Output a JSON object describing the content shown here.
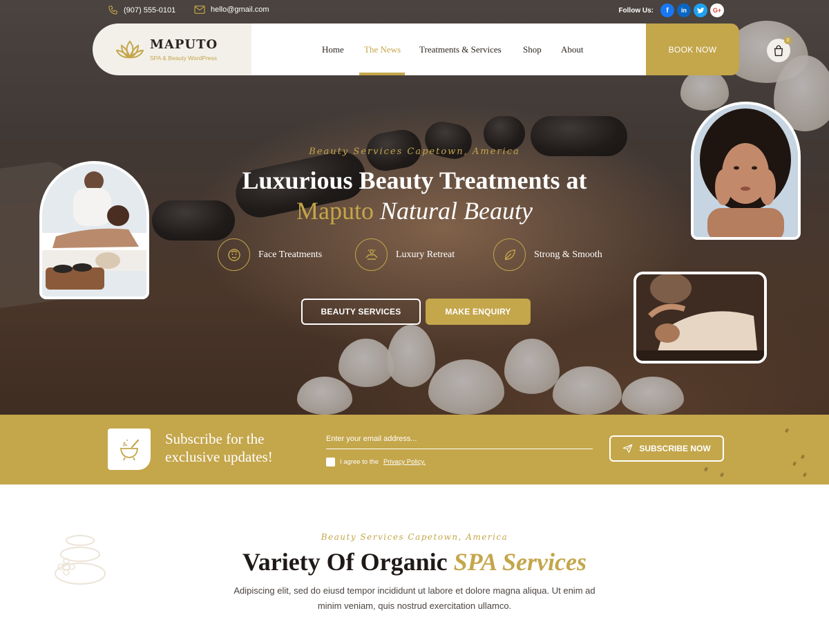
{
  "topbar": {
    "phone": "(907) 555-0101",
    "email": "hello@gmail.com",
    "follow_label": "Follow Us:",
    "social": [
      {
        "icon": "facebook-icon",
        "glyph": "f",
        "color": "#1877f2"
      },
      {
        "icon": "linkedin-icon",
        "glyph": "in",
        "color": "#0a66c2"
      },
      {
        "icon": "twitter-icon",
        "glyph": "t",
        "color": "#1da1f2"
      },
      {
        "icon": "google-plus-icon",
        "glyph": "G+",
        "color": "#ffffff"
      }
    ]
  },
  "nav": {
    "brand_name": "MAPUTO",
    "brand_tagline": "SPA & Beauty WordPress",
    "items": [
      {
        "label": "Home",
        "active": false
      },
      {
        "label": "The News",
        "active": true
      },
      {
        "label": "Treatments & Services",
        "active": false
      },
      {
        "label": "Shop",
        "active": false
      },
      {
        "label": "About",
        "active": false
      }
    ],
    "cart_count": "0",
    "book_label": "BOOK NOW"
  },
  "hero": {
    "eyebrow": "Beauty Services Capetown, America",
    "title_line1": "Luxurious Beauty Treatments at",
    "title_line2_gold": "Maputo",
    "title_line2_script": "Natural Beauty",
    "features": [
      {
        "icon": "face-mask-icon",
        "label": "Face Treatments"
      },
      {
        "icon": "massage-hands-icon",
        "label": "Luxury Retreat"
      },
      {
        "icon": "leaf-icon",
        "label": "Strong & Smooth"
      }
    ],
    "btn_services": "BEAUTY SERVICES",
    "btn_enquiry": "MAKE ENQUIRY"
  },
  "subscribe": {
    "title": "Subscribe for the exclusive updates!",
    "email_placeholder": "Enter your email address...",
    "agree_text": "I agree to the",
    "policy_link": "Privacy Policy.",
    "button": "SUBSCRIBE NOW"
  },
  "services": {
    "eyebrow": "Beauty Services Capetown, America",
    "title_main": "Variety Of Organic",
    "title_gold": "SPA Services",
    "description": "Adipiscing elit, sed do eiusd tempor incididunt ut labore et dolore magna aliqua. Ut enim ad minim veniam, quis nostrud exercitation ullamco."
  },
  "colors": {
    "accent": "#c4a64b",
    "dark_text": "#2b2520",
    "brand_bg": "#f3f0ea"
  }
}
